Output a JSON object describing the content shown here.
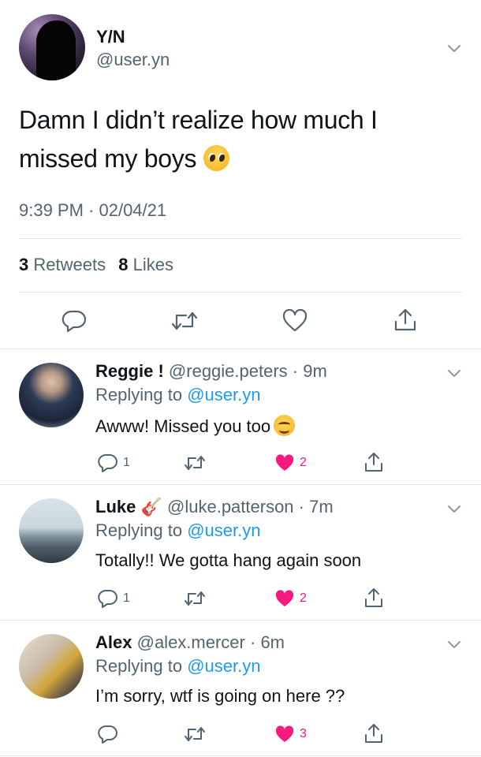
{
  "main_tweet": {
    "display_name": "Y/N",
    "handle": "@user.yn",
    "text_line1": "Damn I didn’t realize how much I",
    "text_line2": "missed my boys",
    "timestamp": "9:39 PM · 02/04/21",
    "retweets_count": "3",
    "retweets_label": "Retweets",
    "likes_count": "8",
    "likes_label": "Likes",
    "icons": [
      "reply-icon",
      "retweet-icon",
      "like-icon",
      "share-icon",
      "chevron-down-icon"
    ],
    "emoji": "pleading-face"
  },
  "replies": [
    {
      "name": "Reggie !",
      "handle": "@reggie.peters",
      "time": "· 9m",
      "replying_prefix": "Replying to",
      "replying_to": "@user.yn",
      "text": "Awww! Missed you too",
      "emoji": "smiling-face",
      "reply_count": "1",
      "like_count": "2",
      "liked": true
    },
    {
      "name": "Luke",
      "handle": "@luke.patterson",
      "time": "· 7m",
      "replying_prefix": "Replying to",
      "replying_to": "@user.yn",
      "text": "Totally!! We gotta hang again soon",
      "emoji": "guitar",
      "reply_count": "1",
      "like_count": "2",
      "liked": true
    },
    {
      "name": "Alex",
      "handle": "@alex.mercer",
      "time": "· 6m",
      "replying_prefix": "Replying to",
      "replying_to": "@user.yn",
      "text": "I’m sorry, wtf is going on here ??",
      "like_count": "3",
      "liked": true
    }
  ],
  "colors": {
    "text": "#0f1419",
    "secondary": "#536471",
    "link": "#1d9bf0",
    "like": "#f91880",
    "divider": "#e1e8ed"
  }
}
